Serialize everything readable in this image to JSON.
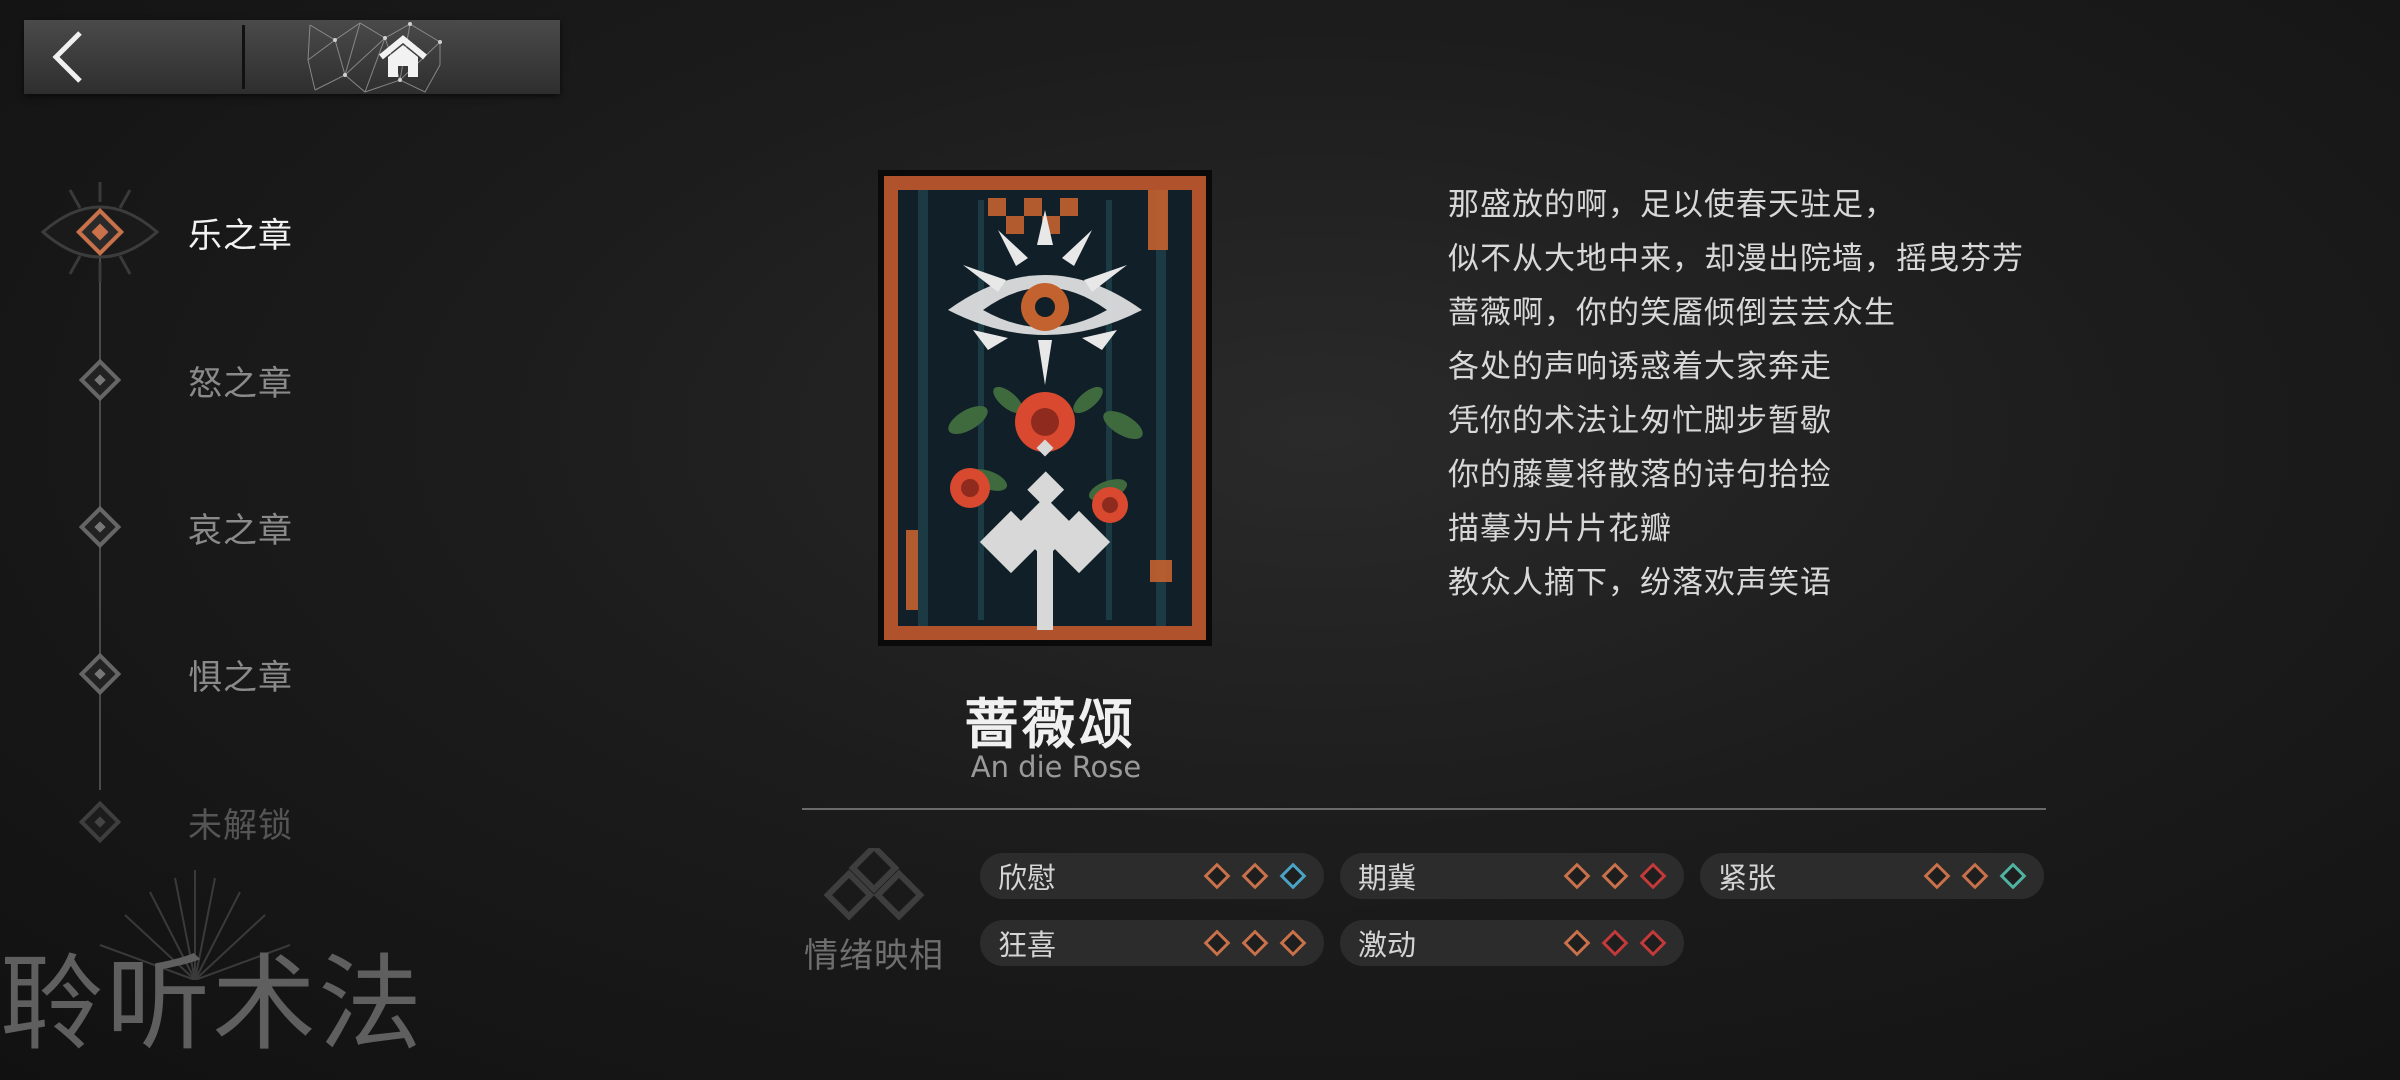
{
  "nav": {
    "back_icon": "chevron-left-icon",
    "home_icon": "home-icon"
  },
  "chapters": [
    {
      "label": "乐之章",
      "state": "active"
    },
    {
      "label": "怒之章",
      "state": "normal"
    },
    {
      "label": "哀之章",
      "state": "normal"
    },
    {
      "label": "惧之章",
      "state": "normal"
    },
    {
      "label": "未解锁",
      "state": "locked"
    }
  ],
  "brand": "聆听术法",
  "song": {
    "title": "蔷薇颂",
    "subtitle": "An die Rose"
  },
  "lyrics": [
    "那盛放的啊，足以使春天驻足，",
    "似不从大地中来，却漫出院墙，摇曳芬芳",
    "蔷薇啊，你的笑靥倾倒芸芸众生",
    "各处的声响诱惑着大家奔走",
    "凭你的术法让匆忙脚步暂歇",
    "你的藤蔓将散落的诗句拾捡",
    "描摹为片片花瓣",
    "教众人摘下，纷落欢声笑语"
  ],
  "emotion": {
    "title": "情绪映相",
    "colors": {
      "orange": "#c8714a",
      "blue": "#4aa3c4",
      "red": "#c43a3a",
      "teal": "#4fb3a0"
    },
    "items": [
      {
        "name": "欣慰",
        "diamonds": [
          "orange",
          "orange",
          "blue"
        ]
      },
      {
        "name": "期冀",
        "diamonds": [
          "orange",
          "orange",
          "red"
        ]
      },
      {
        "name": "紧张",
        "diamonds": [
          "orange",
          "orange",
          "teal"
        ]
      },
      {
        "name": "狂喜",
        "diamonds": [
          "orange",
          "orange",
          "orange"
        ]
      },
      {
        "name": "激动",
        "diamonds": [
          "orange",
          "red",
          "red"
        ]
      }
    ]
  }
}
